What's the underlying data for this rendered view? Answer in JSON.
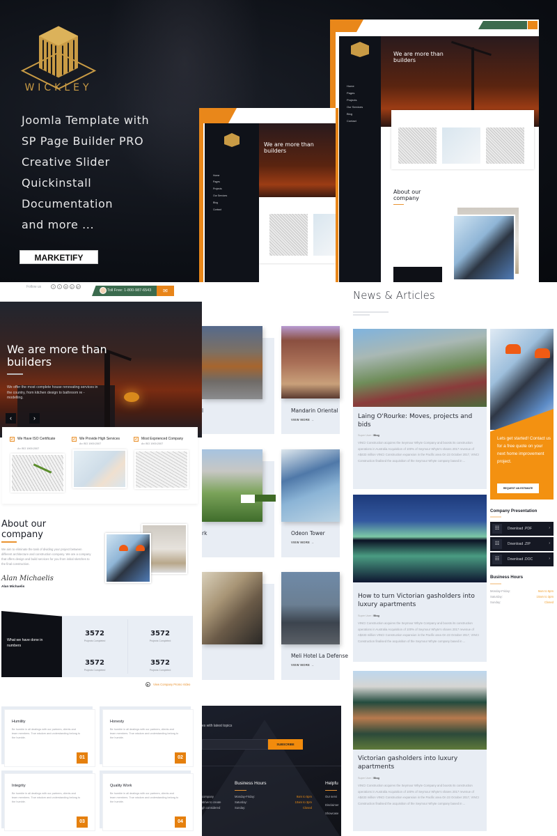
{
  "hero": {
    "logo_text": "WICKLEY",
    "features": [
      "Joomla Template with",
      "SP Page Builder PRO",
      "Creative Slider",
      "Quickinstall",
      "Documentation",
      "and more ..."
    ],
    "badge": "MARKETIFY"
  },
  "mini_screens": {
    "slide_title": "We are more than builders",
    "logo_text": "WICKLEY",
    "nav": [
      "Home",
      "Pages",
      "Projects",
      "Our Services",
      "Blog",
      "Contact"
    ],
    "features": [
      "We Have ISO Certificate",
      "We Provide High Services",
      "Most Experienced Company"
    ],
    "about_title": "About our company",
    "about_signature_name": "Alan Michaelis"
  },
  "topbar": {
    "follow_label": "Follow us",
    "social_icons": [
      "f",
      "t",
      "in",
      "p",
      "g+"
    ],
    "phone": "Toll Free: 1-800-987-6543",
    "mail_icon": "✉"
  },
  "slider": {
    "title_line1": "We are more than",
    "title_line2": "builders",
    "description": "We offer the most complete house renovating services in the country, from kitchen design to bathroom re -modelling.",
    "prev_icon": "‹",
    "next_icon": "›"
  },
  "features": [
    {
      "title": "We Have ISO Certificate",
      "subtitle": "An ISO 1900:2007",
      "check": "✔"
    },
    {
      "title": "We Provide High Services",
      "subtitle": "An ISO 1900:2007",
      "check": "✔"
    },
    {
      "title": "Most Exprienced Company",
      "subtitle": "An ISO 1900:2007",
      "check": "✔"
    }
  ],
  "about": {
    "title_line1": "About our",
    "title_line2": "company",
    "text": "We aim to eliminate the task of dividing your project between different architecture and construction company. We are a company that offers design and build services for you from initial sketches to the final construction.",
    "signature": "Alan Michaelis",
    "name": "Alan Michaelis"
  },
  "numbers": {
    "heading": "What we have done in numbers",
    "stats": [
      {
        "value": "3572",
        "label": "Projects Completed"
      },
      {
        "value": "3572",
        "label": "Projects Completed"
      },
      {
        "value": "3572",
        "label": "Projects Completed"
      },
      {
        "value": "3572",
        "label": "Projects Completed"
      }
    ],
    "promo_link": "View Company Promo Video",
    "promo_icon": "▶"
  },
  "values": [
    {
      "title": "Humility",
      "text": "Be humble in all dealings with our partners, clients and team members. True wisdom and understanding belong to the humble.",
      "number": "01"
    },
    {
      "title": "Honesty",
      "text": "Be humble in all dealings with our partners, clients and team members. True wisdom and understanding belong to the humble.",
      "number": "02"
    },
    {
      "title": "Integrity",
      "text": "Be humble in all dealings with our partners, clients and team members. True wisdom and understanding belong to the humble.",
      "number": "03"
    },
    {
      "title": "Quality Work",
      "text": "Be humble in all dealings with our partners, clients and team members. True wisdom and understanding belong to the humble.",
      "number": "04"
    }
  ],
  "projects": [
    {
      "name": "l",
      "more": ""
    },
    {
      "name": "Mandarin Oriental",
      "more": "VIEW MORE →"
    },
    {
      "name": "rk",
      "more": ""
    },
    {
      "name": "Odeon Tower",
      "more": "VIEW MORE →"
    },
    {
      "name": "",
      "more": ""
    },
    {
      "name": "Meli Hotel La Defense",
      "more": "VIEW MORE →"
    }
  ],
  "footer": {
    "newsletter_text": "es with latest topics",
    "subscribe_label": "SUBSCRIBE",
    "left_lines": [
      "company",
      "strive to create",
      "gh considered"
    ],
    "business_hours_title": "Business Hours",
    "days": [
      "Monday-Friday:",
      "Saturday:",
      "Sunday:"
    ],
    "hours": [
      "9am to 5pm",
      "10am to 3pm",
      "Closed"
    ],
    "helpful_title": "Helpfu",
    "links": [
      "Our servi",
      "Disclaimer",
      "Showcase"
    ]
  },
  "news": {
    "title": "News & Articles",
    "articles": [
      {
        "title": "Laing O'Rourke: Moves, projects and bids",
        "author": "Super User",
        "category": "Blog",
        "excerpt": "VINCI Construction acquires the Seymour Whyte Company and boosts its construction operations in Australia Acquisition of 100% of Seymour Whyte's shares 2017 revenue of A$433 million VINCI Construction expansion in the Pacific area On 23 October 2017, VINCI Construction finalised the acquisition of the Seymour Whyte company based in ..."
      },
      {
        "title": "How to turn Victorian gasholders into luxury apartments",
        "author": "Super User",
        "category": "Blog",
        "excerpt": "VINCI Construction acquires the Seymour Whyte Company and boosts its construction operations in Australia Acquisition of 100% of Seymour Whyte's shares 2017 revenue of A$433 million VINCI Construction expansion in the Pacific area On 23 October 2017, VINCI Construction finalised the acquisition of the Seymour Whyte company based in ..."
      },
      {
        "title": "Victorian gasholders into luxury apartments",
        "author": "Super User",
        "category": "Blog",
        "excerpt": "VINCI Construction acquires the Seymour Whyte Company and boosts its construction operations in Australia Acquisition of 100% of Seymour Whyte's shares 2017 revenue of A$433 million VINCI Construction expansion in the Pacific area On 23 October 2017, VINCI Construction finalised the acquisition of the Seymour Whyte company based in ..."
      }
    ],
    "separator": "/"
  },
  "sidebar": {
    "cta_text": "Lets get started! Contact us for a free quote on your next home improvement project.",
    "cta_button": "REQUEST AN ESTIMATE",
    "presentation_title": "Company Presentation",
    "downloads": [
      {
        "label": "Download .PDF",
        "icon": "☷",
        "arrow": "›"
      },
      {
        "label": "Download .ZIP",
        "icon": "☷",
        "arrow": "›"
      },
      {
        "label": "Download .DOC",
        "icon": "☷",
        "arrow": "›"
      }
    ],
    "hours_title": "Business Hours",
    "days": [
      "Monday-Friday:",
      "Saturday:",
      "Sunday:"
    ],
    "hours": [
      "9am to 5pm",
      "10am to 3pm",
      "Closed"
    ]
  },
  "colors": {
    "accent": "#e9871a",
    "dark": "#0e1016",
    "phone_green": "#3b6b4e",
    "light_bg": "#e8edf4"
  }
}
